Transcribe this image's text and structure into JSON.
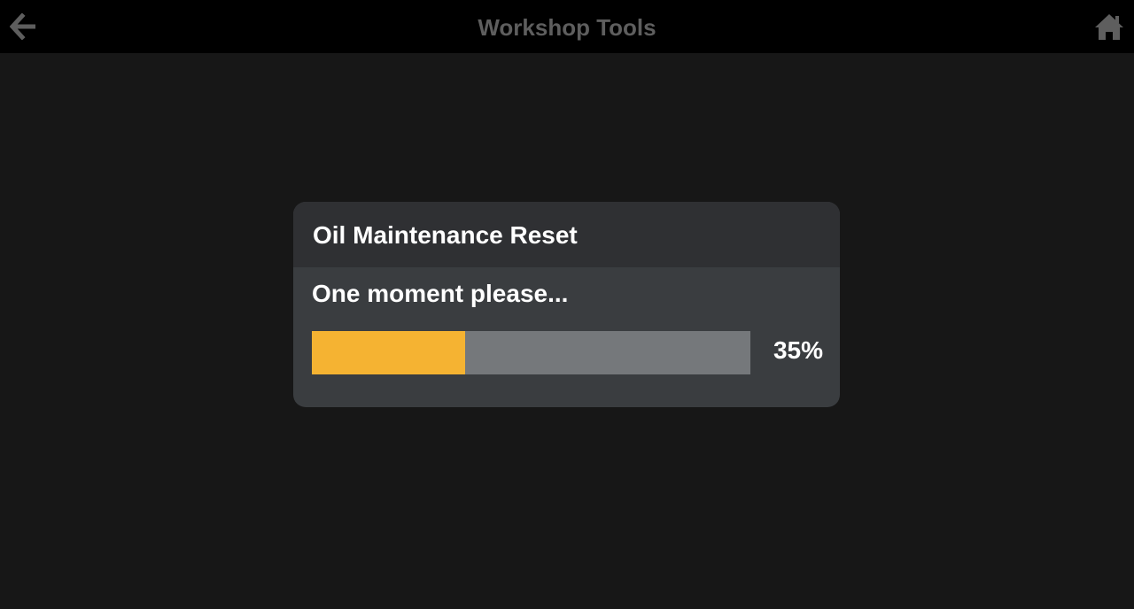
{
  "header": {
    "title": "Workshop Tools",
    "back_icon": "arrow-left-icon",
    "home_icon": "home-icon"
  },
  "dialog": {
    "title": "Oil Maintenance Reset",
    "message": "One moment please...",
    "progress": {
      "value": 0.35,
      "label": "35%"
    }
  },
  "colors": {
    "background": "#171717",
    "topbar": "#000000",
    "title_text": "#5e5e5e",
    "dialog_header": "#2f3033",
    "dialog_body": "#3a3d40",
    "progress_fill": "#f5b332",
    "progress_track": "#75787b",
    "text": "#ffffff"
  }
}
